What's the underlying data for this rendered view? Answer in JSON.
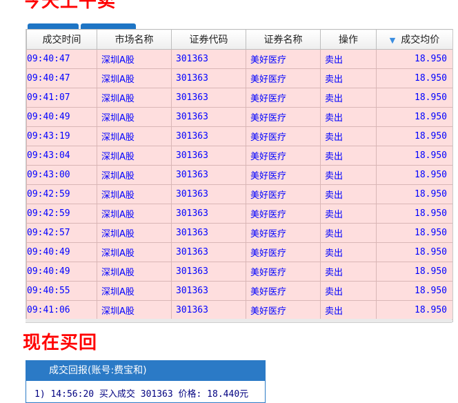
{
  "headings": {
    "sell": "今天上午卖",
    "buy_back": "现在买回"
  },
  "table": {
    "columns": [
      "成交时间",
      "市场名称",
      "证券代码",
      "证券名称",
      "操作",
      "成交均价"
    ],
    "rows": [
      [
        "09:40:47",
        "深圳A股",
        "301363",
        "美好医疗",
        "卖出",
        "18.950"
      ],
      [
        "09:40:47",
        "深圳A股",
        "301363",
        "美好医疗",
        "卖出",
        "18.950"
      ],
      [
        "09:41:07",
        "深圳A股",
        "301363",
        "美好医疗",
        "卖出",
        "18.950"
      ],
      [
        "09:40:49",
        "深圳A股",
        "301363",
        "美好医疗",
        "卖出",
        "18.950"
      ],
      [
        "09:43:19",
        "深圳A股",
        "301363",
        "美好医疗",
        "卖出",
        "18.950"
      ],
      [
        "09:43:04",
        "深圳A股",
        "301363",
        "美好医疗",
        "卖出",
        "18.950"
      ],
      [
        "09:43:00",
        "深圳A股",
        "301363",
        "美好医疗",
        "卖出",
        "18.950"
      ],
      [
        "09:42:59",
        "深圳A股",
        "301363",
        "美好医疗",
        "卖出",
        "18.950"
      ],
      [
        "09:42:59",
        "深圳A股",
        "301363",
        "美好医疗",
        "卖出",
        "18.950"
      ],
      [
        "09:42:57",
        "深圳A股",
        "301363",
        "美好医疗",
        "卖出",
        "18.950"
      ],
      [
        "09:40:49",
        "深圳A股",
        "301363",
        "美好医疗",
        "卖出",
        "18.950"
      ],
      [
        "09:40:49",
        "深圳A股",
        "301363",
        "美好医疗",
        "卖出",
        "18.950"
      ],
      [
        "09:40:55",
        "深圳A股",
        "301363",
        "美好医疗",
        "卖出",
        "18.950"
      ],
      [
        "09:41:06",
        "深圳A股",
        "301363",
        "美好医疗",
        "卖出",
        "18.950"
      ]
    ],
    "sort_icon": "sort-down-icon"
  },
  "report_panel": {
    "title": "成交回报(账号:费宝和)",
    "line": "1) 14:56:20 买入成交 301363 价格: 18.440元"
  },
  "colors": {
    "heading": "#ff0000",
    "row_background": "#fedede",
    "cell_text": "#0000ff",
    "panel_header": "#2b7ac6"
  }
}
